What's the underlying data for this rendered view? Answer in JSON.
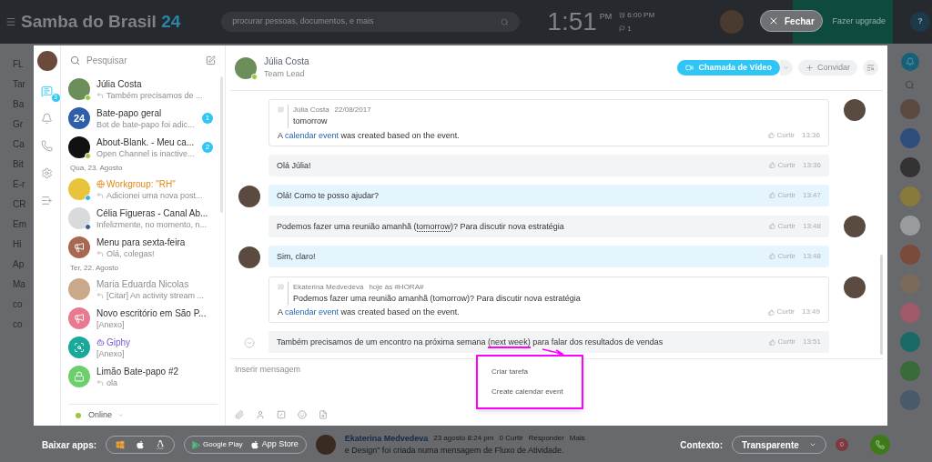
{
  "topbar": {
    "logo": "Samba do Brasil",
    "logo_suffix": "24",
    "search_placeholder": "procurar pessoas, documentos, e mais",
    "time": "1:51",
    "ampm": "PM",
    "alarm": "6:00 PM",
    "flags": "1",
    "upgrade": "Fazer upgrade",
    "help": "?"
  },
  "close_button": "Fechar",
  "background_menu": [
    "FL",
    "Tar",
    "Ba",
    "Gr",
    "Ca",
    "Bit",
    "E-r",
    "CR",
    "Em",
    "Hi",
    "Ap",
    "Ma",
    "co",
    "co"
  ],
  "rail": [
    {
      "kind": "chat",
      "selected": true,
      "badge": "3"
    },
    {
      "kind": "bell",
      "selected": false
    },
    {
      "kind": "phone",
      "selected": false
    },
    {
      "kind": "gear",
      "selected": false
    },
    {
      "kind": "add",
      "selected": false
    }
  ],
  "search": {
    "placeholder": "Pesquisar"
  },
  "chats": [
    {
      "kind": "photo",
      "name": "Júlia Costa",
      "preview": "Também precisamos de ...",
      "replied": true,
      "online": true,
      "network": false,
      "facebook": false,
      "group": false,
      "bot": false,
      "muted": false,
      "color": "#6b8e5a"
    },
    {
      "kind": "text",
      "avatar_text": "24",
      "name": "Bate-papo geral",
      "preview": "Bot de bate-papo foi adic...",
      "replied": false,
      "online": false,
      "network": false,
      "facebook": false,
      "group": false,
      "bot": false,
      "muted": false,
      "color": "#2f5fa8",
      "unread": "1"
    },
    {
      "kind": "photo",
      "name": "About-Blank. - Meu ca...",
      "preview": "Open Channel is inactive...",
      "replied": false,
      "online": true,
      "network": false,
      "facebook": false,
      "group": false,
      "bot": false,
      "muted": false,
      "color": "#111111",
      "unread": "2"
    },
    {
      "kind": "separator",
      "label": "Qua, 23. Agosto"
    },
    {
      "kind": "photo",
      "name": "Workgroup: \"RH\"",
      "preview": "Adicionei uma nova post...",
      "replied": true,
      "online": false,
      "network": true,
      "facebook": false,
      "group": true,
      "bot": false,
      "muted": false,
      "color": "#e8c43a"
    },
    {
      "kind": "photo",
      "name": "Célia Figueras - Canal Ab...",
      "preview": "Infelizmente, no momento, n...",
      "replied": false,
      "online": false,
      "network": false,
      "facebook": true,
      "group": false,
      "bot": false,
      "muted": false,
      "color": "#d8dadc"
    },
    {
      "kind": "megaphone",
      "name": "Menu para sexta-feira",
      "preview": "Olá, colegas!",
      "replied": true,
      "online": false,
      "network": false,
      "facebook": false,
      "group": false,
      "bot": false,
      "muted": false,
      "color": "#a8674f"
    },
    {
      "kind": "separator",
      "label": "Ter, 22. Agosto"
    },
    {
      "kind": "photo",
      "name": "Maria Eduarda Nicolas",
      "preview": "[Citar] An activity stream ...",
      "replied": true,
      "online": false,
      "network": false,
      "facebook": false,
      "group": false,
      "bot": false,
      "muted": true,
      "color": "#c9a98a"
    },
    {
      "kind": "megaphone",
      "name": "Novo escritório em São P...",
      "preview": "[Anexo]",
      "replied": false,
      "online": false,
      "network": false,
      "facebook": false,
      "group": false,
      "bot": false,
      "muted": false,
      "color": "#e8798f"
    },
    {
      "kind": "search",
      "name": "Giphy",
      "preview": "[Anexo]",
      "replied": false,
      "online": false,
      "network": false,
      "facebook": false,
      "group": false,
      "bot": true,
      "muted": false,
      "color": "#19a99a"
    },
    {
      "kind": "lock",
      "name": "Limão Bate-papo #2",
      "preview": "ola",
      "replied": true,
      "online": false,
      "network": false,
      "facebook": false,
      "group": false,
      "bot": false,
      "muted": false,
      "color": "#6ccf6c"
    }
  ],
  "status": {
    "label": "Online",
    "online": true
  },
  "chat_header": {
    "name": "Júlia Costa",
    "role": "Team Lead",
    "online": true,
    "video_button": "Chamada de Vídeo",
    "invite_button": "Convidar"
  },
  "messages": [
    {
      "kind": "quote",
      "outgoing": true,
      "avatar": true,
      "quote_author": "Júlia Costa",
      "quote_date": "22/08/2017",
      "quote_text": "tomorrow",
      "parts": [
        {
          "kind": "plain",
          "text": "A "
        },
        {
          "kind": "link",
          "text": "calendar event"
        },
        {
          "kind": "plain",
          "text": " was created based on the event."
        }
      ],
      "like": "Curtir",
      "time": "13:36"
    },
    {
      "kind": "text",
      "outgoing": true,
      "avatar": false,
      "parts": [
        {
          "kind": "plain",
          "text": "Olá Júlia!"
        }
      ],
      "like": "Curtir",
      "time": "13:36"
    },
    {
      "kind": "text",
      "outgoing": false,
      "avatar": true,
      "parts": [
        {
          "kind": "plain",
          "text": "Olá! Como te posso ajudar?"
        }
      ],
      "like": "Curtir",
      "time": "13:47"
    },
    {
      "kind": "text",
      "outgoing": true,
      "avatar": true,
      "parts": [
        {
          "kind": "plain",
          "text": "Podemos fazer uma reunião amanhã ("
        },
        {
          "kind": "dotted",
          "text": "tomorrow"
        },
        {
          "kind": "plain",
          "text": ")? Para discutir nova estratégia"
        }
      ],
      "like": "Curtir",
      "time": "13:48"
    },
    {
      "kind": "text",
      "outgoing": false,
      "avatar": true,
      "parts": [
        {
          "kind": "plain",
          "text": "Sim, claro!"
        }
      ],
      "like": "Curtir",
      "time": "13:48"
    },
    {
      "kind": "quote",
      "outgoing": true,
      "avatar": true,
      "quote_author": "Ekaterina Medvedeva",
      "quote_date": "hoje às #HORA#",
      "quote_text": "Podemos fazer uma reunião amanhã (tomorrow)? Para discutir nova estratégia",
      "parts": [
        {
          "kind": "plain",
          "text": "A "
        },
        {
          "kind": "link",
          "text": "calendar event"
        },
        {
          "kind": "plain",
          "text": " was created based on the event."
        }
      ],
      "like": "Curtir",
      "time": "13:49"
    },
    {
      "kind": "text",
      "outgoing": true,
      "avatar": false,
      "menu_open": true,
      "parts": [
        {
          "kind": "plain",
          "text": "Também precisamos de um encontro na próxima semana "
        },
        {
          "kind": "marked",
          "text": "(next week)"
        },
        {
          "kind": "plain",
          "text": " para falar dos resultados de vendas"
        }
      ],
      "like": "Curtir",
      "time": "13:51"
    }
  ],
  "context_menu": [
    "Criar tarefa",
    "Create calendar event"
  ],
  "composer": {
    "placeholder": "Inserir mensagem"
  },
  "bottom_bar": {
    "apps_label": "Baixar apps:",
    "stores": [
      "Google Play",
      "App Store"
    ],
    "feed_author": "Ekaterina Medvedeva",
    "feed_date": "23 agosto 8:24 pm",
    "feed_likes": "0 Curtir",
    "feed_reply": "Responder",
    "feed_more": "Mais",
    "feed_text": "e Design\" foi criada numa mensagem de Fluxo de Atividade.",
    "context_label": "Contexto:",
    "context_value": "Transparente",
    "counter": "0"
  }
}
